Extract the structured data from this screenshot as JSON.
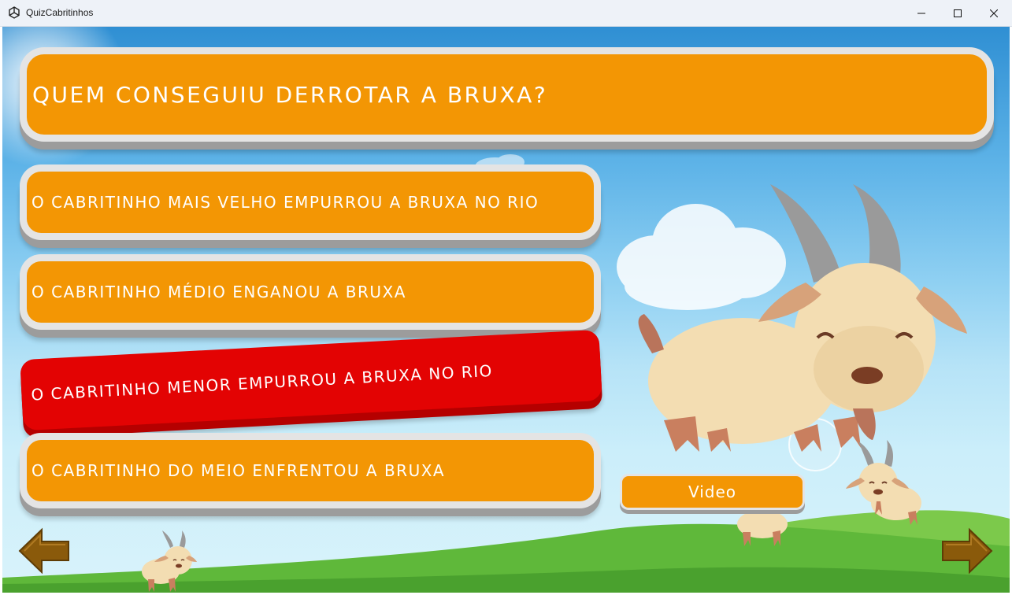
{
  "window": {
    "title": "QuizCabritinhos",
    "icon": "unity-logo-icon"
  },
  "quiz": {
    "question": "QUEM CONSEGUIU DERROTAR A BRUXA?",
    "answers": [
      {
        "label": "O CABRITINHO MAIS VELHO EMPURROU A BRUXA NO RIO",
        "state": "normal"
      },
      {
        "label": "O CABRITINHO MÉDIO ENGANOU A BRUXA",
        "state": "normal"
      },
      {
        "label": "O CABRITINHO MENOR EMPURROU A BRUXA NO RIO",
        "state": "wrong"
      },
      {
        "label": "O CABRITINHO DO MEIO ENFRENTOU A BRUXA",
        "state": "normal"
      }
    ],
    "video_label": "Video"
  },
  "navigation": {
    "prev_icon": "arrow-left-icon",
    "next_icon": "arrow-right-icon"
  },
  "colors": {
    "button_orange": "#f39604",
    "wrong_red": "#e30303",
    "button_border": "#e4e4e4",
    "arrow_brown": "#8a5a0b",
    "grass_green": "#5fb83a"
  }
}
